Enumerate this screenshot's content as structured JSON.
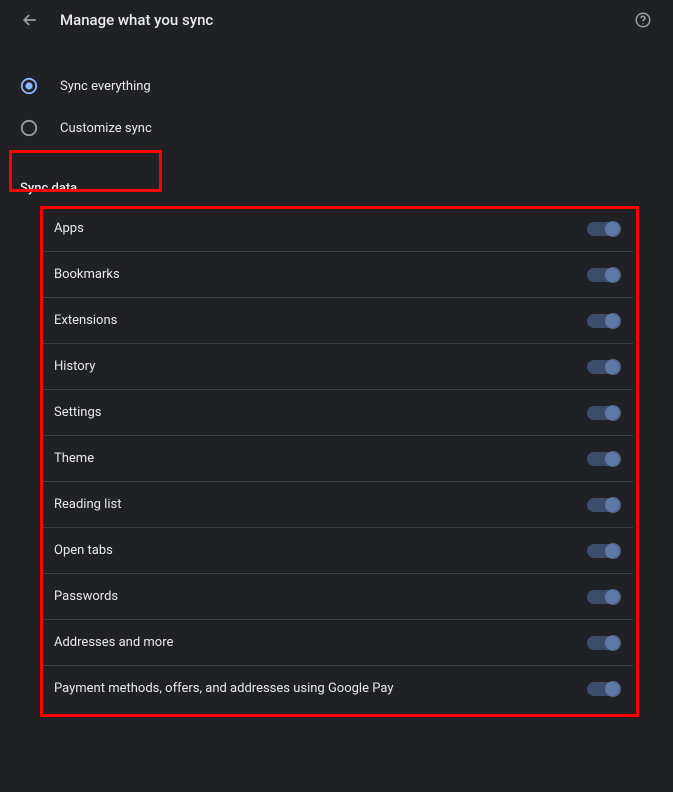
{
  "header": {
    "title": "Manage what you sync"
  },
  "radios": {
    "everything": "Sync everything",
    "customize": "Customize sync",
    "selected": "everything"
  },
  "section_title": "Sync data",
  "items": [
    {
      "label": "Apps",
      "on": true
    },
    {
      "label": "Bookmarks",
      "on": true
    },
    {
      "label": "Extensions",
      "on": true
    },
    {
      "label": "History",
      "on": true
    },
    {
      "label": "Settings",
      "on": true
    },
    {
      "label": "Theme",
      "on": true
    },
    {
      "label": "Reading list",
      "on": true
    },
    {
      "label": "Open tabs",
      "on": true
    },
    {
      "label": "Passwords",
      "on": true
    },
    {
      "label": "Addresses and more",
      "on": true
    },
    {
      "label": "Payment methods, offers, and addresses using Google Pay",
      "on": true
    }
  ],
  "accent": "#8ab4f8"
}
